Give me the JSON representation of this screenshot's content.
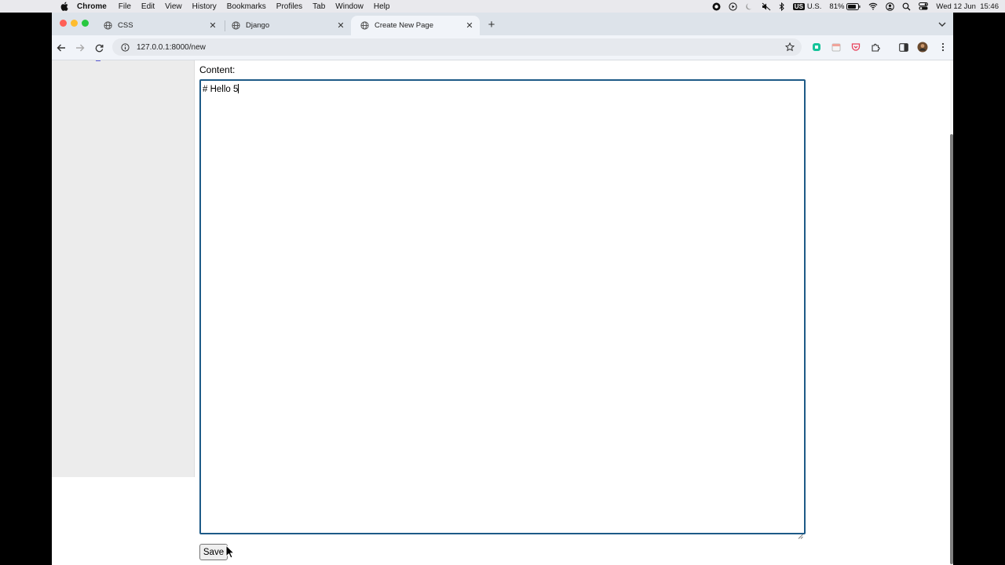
{
  "menubar": {
    "app_name": "Chrome",
    "items": [
      "File",
      "Edit",
      "View",
      "History",
      "Bookmarks",
      "Profiles",
      "Tab",
      "Window",
      "Help"
    ],
    "input_source_badge": "US",
    "input_source_label": "U.S.",
    "battery_percent": "81%",
    "datetime": "Wed 12 Jun  15:46"
  },
  "tabs": [
    {
      "title": "CSS",
      "active": false
    },
    {
      "title": "Django",
      "active": false
    },
    {
      "title": "Create New Page",
      "active": true
    }
  ],
  "toolbar": {
    "url": "127.0.0.1:8000/new"
  },
  "page": {
    "content_label": "Content:",
    "content_value": "# Hello 5",
    "save_label": "Save"
  },
  "colors": {
    "textarea_focus_border": "#1d5a87",
    "tabstrip_bg": "#dde3ea",
    "toolbar_bg": "#f1f4f9",
    "sidebar_bg": "#ececec",
    "traffic_close": "#ff5f57",
    "traffic_minimize": "#febc2e",
    "traffic_zoom": "#28c840"
  },
  "icons": {
    "tab_favicon": "globe-icon",
    "back": "arrow-left-icon",
    "forward": "arrow-right-icon",
    "reload": "reload-icon",
    "site_info": "info-icon",
    "bookmark": "star-icon",
    "extensions": "puzzle-icon",
    "side_panel": "side-panel-icon",
    "menu": "more-vertical-icon"
  }
}
